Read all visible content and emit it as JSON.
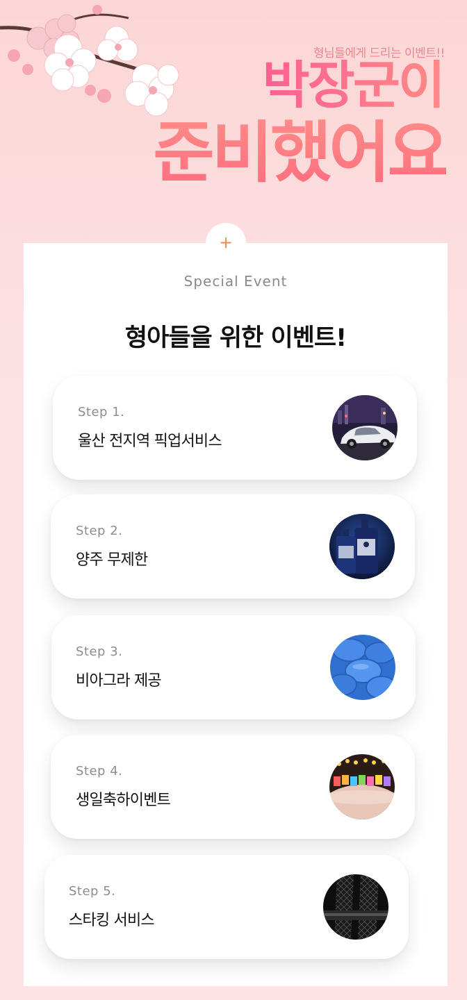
{
  "header": {
    "tagline": "형님들에게 드리는 이벤트!!",
    "headline_line1": "박장군이",
    "headline_line2": "준비했어요"
  },
  "panel": {
    "plus_symbol": "+",
    "section_label": "Special Event",
    "section_title": "형아들을 위한 이벤트!"
  },
  "steps": [
    {
      "step": "Step 1.",
      "desc": "울산 전지역 픽업서비스",
      "icon": "car-photo"
    },
    {
      "step": "Step 2.",
      "desc": "양주 무제한",
      "icon": "liquor-bottle-photo"
    },
    {
      "step": "Step 3.",
      "desc": "비아그라 제공",
      "icon": "blue-pill-photo"
    },
    {
      "step": "Step 4.",
      "desc": "생일축하이벤트",
      "icon": "birthday-cake-photo"
    },
    {
      "step": "Step 5.",
      "desc": "스타킹 서비스",
      "icon": "stocking-photo"
    }
  ],
  "colors": {
    "background": "#fde0e0",
    "headline_pink": "#ff6f8a",
    "headline_coral": "#ff7b80",
    "plus_orange": "#f08a55",
    "panel": "#ffffff"
  }
}
